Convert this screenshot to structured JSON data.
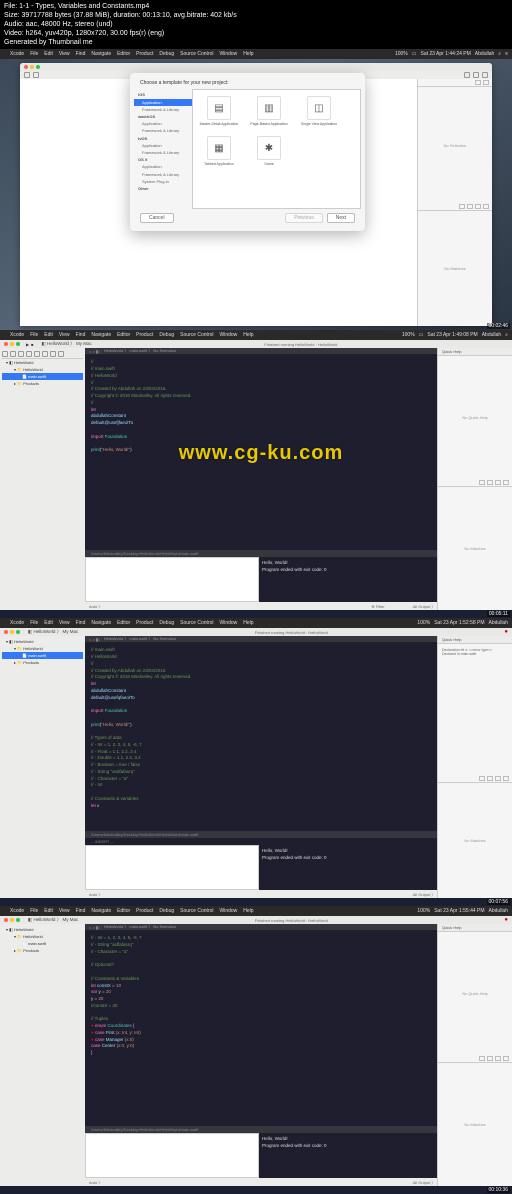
{
  "meta": {
    "file": "File: 1-1 - Types, Variables and Constants.mp4",
    "size": "Size: 39717788 bytes (37.88 MiB), duration: 00:13:10, avg.bitrate: 402 kb/s",
    "audio": "Audio: aac, 48000 Hz, stereo (und)",
    "video": "Video: h264, yuv420p, 1280x720, 30.00 fps(r) (eng)",
    "gen": "Generated by Thumbnail me"
  },
  "menubar": {
    "app": "Xcode",
    "items": [
      "File",
      "Edit",
      "View",
      "Find",
      "Navigate",
      "Editor",
      "Product",
      "Debug",
      "Source Control",
      "Window",
      "Help"
    ],
    "status_pct": "100%",
    "user": "Abdullah"
  },
  "times": {
    "t1": "Sat 23 Apr  1:44:24 PM",
    "t2": "Sat 23 Apr  1:49:08 PM",
    "t3": "Sat 23 Apr  1:52:58 PM",
    "t4": "Sat 23 Apr  1:55:44 PM"
  },
  "stamps": {
    "s1": "00:02:46",
    "s2": "00:05:11",
    "s3": "00:07:56",
    "s4": "00:10:36"
  },
  "modal": {
    "title": "Choose a template for your new project:",
    "sidebar": {
      "ios": "iOS",
      "ios_items": [
        "Application",
        "Framework & Library"
      ],
      "watchos": "watchOS",
      "watchos_items": [
        "Application",
        "Framework & Library"
      ],
      "tvos": "tvOS",
      "tvos_items": [
        "Application",
        "Framework & Library"
      ],
      "osx": "OS X",
      "osx_items": [
        "Application",
        "Framework & Library",
        "System Plug-in"
      ],
      "other": "Other"
    },
    "templates": {
      "t1": "Master-Detail Application",
      "t2": "Page-Based Application",
      "t3": "Single View Application",
      "t4": "Tabbed Application",
      "t5": "Game"
    },
    "cancel": "Cancel",
    "prev": "Previous",
    "next": "Next"
  },
  "inspector": {
    "no_selection": "No Selection",
    "no_matches": "No Matches",
    "quick_help": "Quick Help",
    "no_quick_help": "No Quick Help",
    "decl": "Declaration let x: <<error type>>",
    "declin": "Declared in  main.swift"
  },
  "project": {
    "name": "HelloWorld",
    "scheme": "My Mac",
    "status": "Finished running HelloWorld : HelloWorld",
    "folder": "HelloWorld",
    "file": "main.swift",
    "products": "Products",
    "breadcrumb": "HelloWorld 〉 main.swift 〉 No Selection"
  },
  "code1": {
    "l1": "//",
    "l2": "//  main.swift",
    "l3": "//  HelloWorld",
    "l4": "//",
    "l5": "//  Created by Abdullah on 23/04/2016.",
    "l6": "//  Copyright © 2016 Mindvalley. All rights reserved.",
    "l7": "//",
    "l8": "let",
    "l9": "abdullahConstant",
    "l10": "default@usefjfaeolTo",
    "l11": "import Foundation",
    "l12": "print(\"Hello, World!\")"
  },
  "code2": {
    "l1": "//  main.swift",
    "l2": "//  HelloWorld",
    "l3": "//",
    "l4": "//  Created by Abdullah on 23/04/2016.",
    "l5": "//  Copyright © 2016 Mindvalley. All rights reserved.",
    "l6": "let",
    "l7": "abdullahConstant",
    "l8": "default@usefqfaeolTo",
    "l9": "import Foundation",
    "l10": "print(\"Hello, World!\")",
    "l11": "// Types of data",
    "l12": "//  - Int = 1, 2, 3, 4, 5, -6, 7",
    "l13": "//  - Float = 1.1, 2.2, 3.4",
    "l14": "//  - Double = 1.1, 2.2, 3.4",
    "l15": "//  - Boolean = true / false",
    "l16": "//  - String \"asdfafasrq\"",
    "l17": "//  - Character = \"a\"",
    "l18": "//  - Int",
    "l19": "// Constants & variables",
    "l20": "let x"
  },
  "code3": {
    "l1": "//  - Int = 1, 2, 3, 4, 5, -6, 7",
    "l2": "//  - String \"asffafasrq\"",
    "l3": "//  - Character = \"a\"",
    "l4": "// Optional?",
    "l5": "// Constants & Variables",
    "l6": "let constX = 10",
    "l7": "var y = 20",
    "l8": "y = 30",
    "l9": "//constX = 40",
    "l10": "// Tuples",
    "l11": "enum Coordinates {",
    "l12": "    case First (x: Int, y: Int)",
    "l13": "    case Manager (x:0)",
    "l14": "    case Center (x:0, y:0)",
    "l15": "}"
  },
  "console": {
    "l1": "Hello, World!",
    "l2": "Program ended with exit code: 0"
  },
  "footer": {
    "auto": "Auto ⟩",
    "filter": "⊕ Filter",
    "alloutput": "All Output ⟩",
    "path1": "/Users/Mindvalley/Desktop/HelloWorld/HelloWorld/main.swift",
    "insert": "-- INSERT --"
  },
  "watermark": "www.cg-ku.com"
}
